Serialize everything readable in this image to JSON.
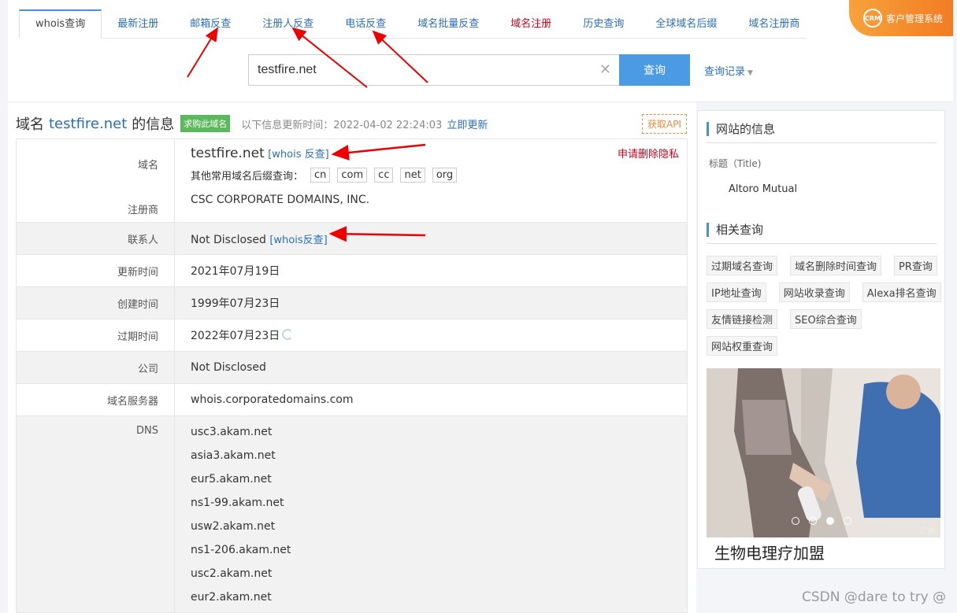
{
  "nav": {
    "tabs": [
      {
        "label": "whois查询"
      },
      {
        "label": "最新注册"
      },
      {
        "label": "邮箱反查"
      },
      {
        "label": "注册人反查"
      },
      {
        "label": "电话反查"
      },
      {
        "label": "域名批量反查"
      },
      {
        "label": "域名注册"
      },
      {
        "label": "历史查询"
      },
      {
        "label": "全球域名后缀"
      },
      {
        "label": "域名注册商"
      }
    ],
    "crm_badge": "CRM",
    "crm_label": "客户管理系统"
  },
  "search": {
    "value": "testfire.net",
    "button": "查询",
    "history": "查询记录"
  },
  "main": {
    "title_prefix": "域名",
    "title_domain": "testfire.net",
    "title_suffix": "的信息",
    "buy_badge": "求购此域名",
    "update_text": "以下信息更新时间：2022-04-02 22:24:03",
    "update_link": "立即更新",
    "api_label": "获取API",
    "rows": {
      "domain": {
        "key": "域名",
        "value": "testfire.net",
        "link": "[whois 反查]",
        "delete": "申请删除隐私"
      },
      "suffix_label": "其他常用域名后缀查询：",
      "suffixes": [
        "cn",
        "com",
        "cc",
        "net",
        "org"
      ],
      "registrar": {
        "key": "注册商",
        "value": "CSC CORPORATE DOMAINS, INC."
      },
      "contact": {
        "key": "联系人",
        "value": "Not Disclosed",
        "link": "[whois反查]"
      },
      "updated": {
        "key": "更新时间",
        "value": "2021年07月19日"
      },
      "created": {
        "key": "创建时间",
        "value": "1999年07月23日"
      },
      "expires": {
        "key": "过期时间",
        "value": "2022年07月23日"
      },
      "company": {
        "key": "公司",
        "value": "Not Disclosed"
      },
      "nameserver": {
        "key": "域名服务器",
        "value": "whois.corporatedomains.com"
      },
      "dns": {
        "key": "DNS",
        "values": [
          "usc3.akam.net",
          "asia3.akam.net",
          "eur5.akam.net",
          "ns1-99.akam.net",
          "usw2.akam.net",
          "ns1-206.akam.net",
          "usc2.akam.net",
          "eur2.akam.net"
        ]
      }
    }
  },
  "sidebar": {
    "site_info_title": "网站的信息",
    "title_label": "标题（Title)",
    "title_value": "Altoro Mutual",
    "related_title": "相关查询",
    "related": [
      "过期域名查询",
      "域名删除时间查询",
      "PR查询",
      "IP地址查询",
      "网站收录查询",
      "Alexa排名查询",
      "友情链接检测",
      "SEO综合查询",
      "网站权重查询"
    ],
    "ad_caption": "生物电理疗加盟",
    "ad_tag": "广告"
  },
  "watermark": "CSDN @dare to try @",
  "colors": {
    "accent": "#4a9be3",
    "link": "#2a6ebb",
    "red": "#d0021b",
    "green": "#5cb85c",
    "orange": "#f27c24"
  }
}
